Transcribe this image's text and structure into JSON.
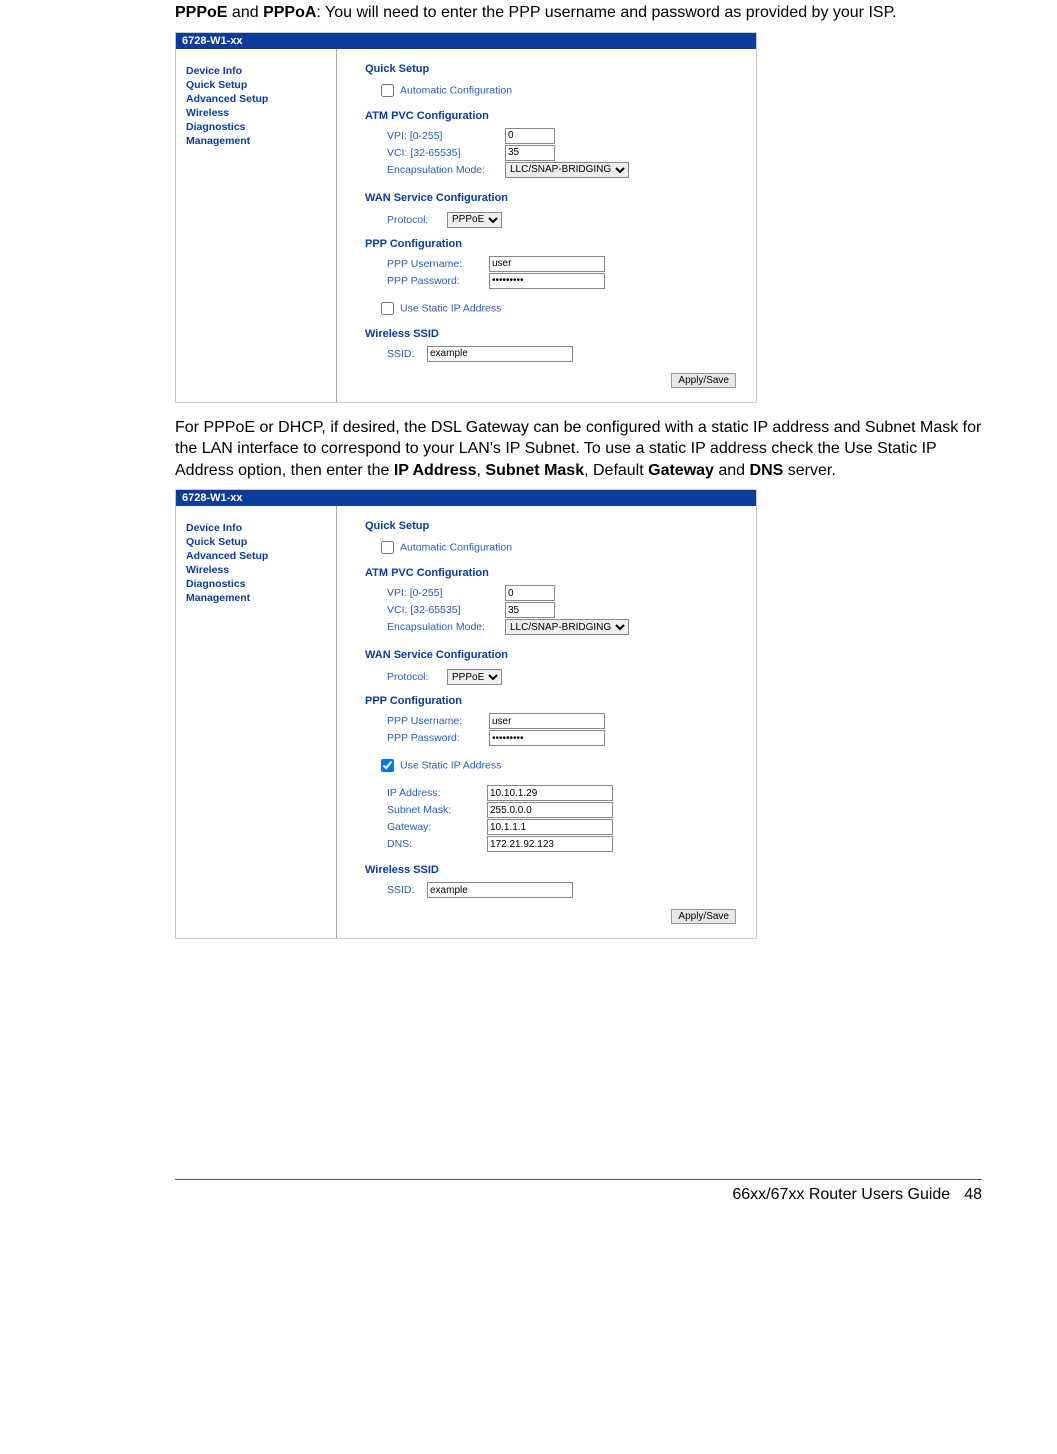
{
  "intro1_a": "PPPoE",
  "intro1_mid": " and ",
  "intro1_b": "PPPoA",
  "intro1_rest": ":  You will need to enter the PPP username and password as provided by your ISP.",
  "intro2_a": "For PPPoE or DHCP, if desired, the DSL Gateway can be configured with a static IP address and Subnet Mask for the LAN interface to correspond to your LAN's IP Subnet. To use a static IP address check the Use Static IP Address option, then enter the ",
  "intro2_b1": "IP Address",
  "intro2_c": ", ",
  "intro2_b2": "Subnet Mask",
  "intro2_d": ", Default ",
  "intro2_b3": "Gateway",
  "intro2_e": " and ",
  "intro2_b4": "DNS",
  "intro2_f": " server.",
  "router": {
    "model": "6728-W1-xx",
    "nav": {
      "device_info": "Device Info",
      "quick_setup": "Quick Setup",
      "advanced_setup": "Advanced Setup",
      "wireless": "Wireless",
      "diagnostics": "Diagnostics",
      "management": "Management"
    },
    "quick_title": "Quick Setup",
    "auto_cfg": "Automatic Configuration",
    "atm_title": "ATM PVC Configuration",
    "vpi_lbl": "VPI: [0-255]",
    "vpi_val": "0",
    "vci_lbl": "VCI: [32-65535]",
    "vci_val": "35",
    "encap_lbl": "Encapsulation Mode:",
    "encap_val": "LLC/SNAP-BRIDGING",
    "wan_title": "WAN Service Configuration",
    "proto_lbl": "Protocol:",
    "proto_val": "PPPoE",
    "ppp_title": "PPP Configuration",
    "ppp_user_lbl": "PPP Username:",
    "ppp_user_val": "user",
    "ppp_pass_lbl": "PPP Password:",
    "ppp_pass_val": "•••••••••",
    "use_static": "Use Static IP Address",
    "ip_addr_lbl": "IP Address:",
    "ip_addr_val": "10.10.1.29",
    "subnet_lbl": "Subnet Mask:",
    "subnet_val": "255.0.0.0",
    "gateway_lbl": "Gateway:",
    "gateway_val": "10.1.1.1",
    "dns_lbl": "DNS:",
    "dns_val": "172.21.92.123",
    "ssid_title": "Wireless SSID",
    "ssid_lbl": "SSID:",
    "ssid_val": "example",
    "apply": "Apply/Save"
  },
  "footer": {
    "guide": "66xx/67xx Router Users Guide",
    "page": "48"
  }
}
